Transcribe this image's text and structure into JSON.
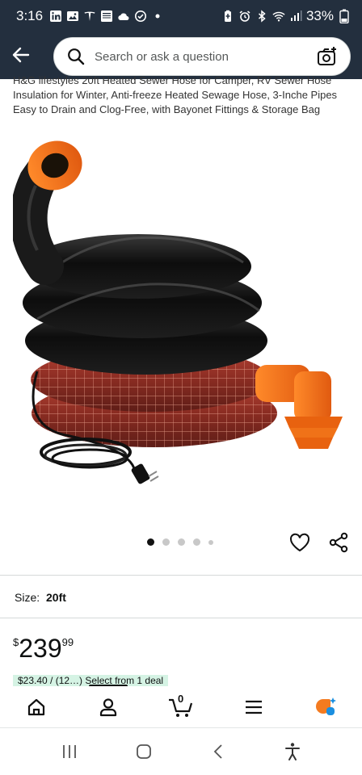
{
  "status_bar": {
    "time": "3:16",
    "battery": "33%",
    "left_icons": [
      "linkedin-icon",
      "gallery-icon",
      "tesla-icon",
      "news-icon",
      "cloud-icon",
      "check-circle-icon",
      "dot-icon"
    ],
    "right_icons": [
      "battery-saver-icon",
      "alarm-icon",
      "bluetooth-icon",
      "wifi-icon",
      "signal-icon"
    ]
  },
  "header": {
    "search_placeholder": "Search or ask a question",
    "icons": [
      "back-arrow-icon",
      "search-icon",
      "camera-icon"
    ]
  },
  "product": {
    "title": "H&G lifestyles 20ft Heated Sewer Hose for Camper, RV Sewer Hose Insulation for Winter, Anti-freeze Heated Sewage Hose, 3-Inche Pipes Easy to Drain and Clog-Free, with Bayonet Fittings & Storage Bag",
    "image_alt": "Black and red heated sewer hose coil with orange fittings and power cord",
    "carousel": {
      "total_dots": 5,
      "active_index": 0
    },
    "size_label": "Size:",
    "size_value": "20ft",
    "price_symbol": "$",
    "price_whole": "239",
    "price_fraction": "99",
    "promo_text": "$23.40  /  (12…)  Select from 1 deal"
  },
  "bottom_nav": {
    "items": [
      "home-icon",
      "account-icon",
      "cart-icon",
      "menu-icon",
      "ai-assistant-icon"
    ],
    "cart_count": "0",
    "active_index": 1
  },
  "system_nav": {
    "items": [
      "recents-icon",
      "home-button-icon",
      "back-icon",
      "accessibility-icon"
    ]
  },
  "colors": {
    "header_bg": "#232f3e",
    "orange": "#f47b20",
    "teal": "#007185"
  }
}
